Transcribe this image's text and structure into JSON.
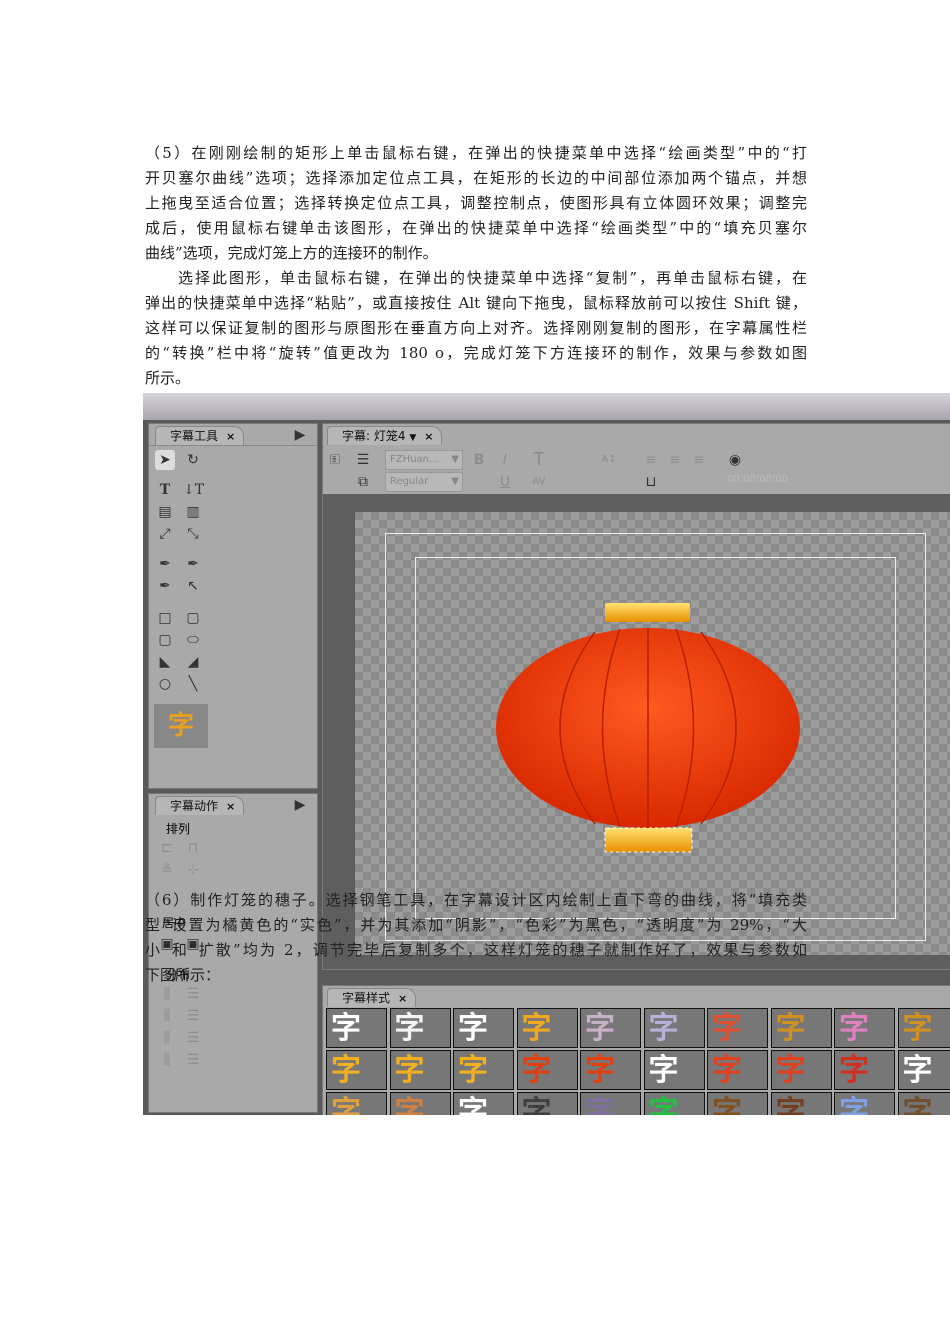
{
  "paragraph1": [
    "（5）在刚刚绘制的矩形上单击鼠标右键，在弹出的快捷菜单中选择“绘画类型”中的“打",
    "开贝塞尔曲线”选项；选择添加定位点工具，在矩形的长边的中间部位添加两个锚点，并想",
    "上拖曳至适合位置；选择转换定位点工具，调整控制点，使图形具有立体圆环效果；调整完",
    "成后，使用鼠标右键单击该图形，在弹出的快捷菜单中选择“绘画类型”中的“填充贝塞尔",
    "曲线”选项，完成灯笼上方的连接环的制作。"
  ],
  "paragraph2": [
    "选择此图形，单击鼠标右键，在弹出的快捷菜单中选择“复制”，再单击鼠标右键，在",
    "弹出的快捷菜单中选择“粘贴”，或直接按住 Alt 键向下拖曳，鼠标释放前可以按住 Shift 键，",
    "这样可以保证复制的图形与原图形在垂直方向上对齐。选择刚刚复制的图形，在字幕属性栏",
    "的“转换”栏中将“旋转”值更改为 180 o，完成灯笼下方连接环的制作，效果与参数如图",
    "所示。"
  ],
  "paragraph3": [
    "（6）制作灯笼的穗子。选择钢笔工具，在字幕设计区内绘制上直下弯的曲线，将“填充类",
    "型”设置为橘黄色的“实色”，并为其添加“阴影”，“色彩”为黑色，“透明度”为 29%，“大",
    "小”和“扩散”均为 2，调节完毕后复制多个，这样灯笼的穗子就制作好了，效果与参数如",
    "下图所示："
  ],
  "screenshot": {
    "tools_panel": {
      "title": "字幕工具",
      "close": "×"
    },
    "actions_panel": {
      "title": "字幕动作",
      "close": "×",
      "arrange": "排列",
      "center": "居中",
      "distribute": "分布"
    },
    "title_tab": {
      "label": "字幕: 灯笼4",
      "close": "×"
    },
    "toolbar": {
      "font": "FZHuan...",
      "style": "Regular",
      "bold": "B",
      "italic": "I",
      "underline": "U",
      "timecode": "00;00;00;00"
    },
    "styles_panel": {
      "title": "字幕样式",
      "close": "×",
      "sample_char": "字",
      "cell_colors": [
        "#ffffff",
        "#f4f4f4",
        "#ffffff",
        "#f0a820",
        "#c8b0c8",
        "#b8b0d8",
        "#e05030",
        "#d09020",
        "#e080c0",
        "#d09020",
        "#f0b020",
        "#f0b020",
        "#f0b020",
        "#e04010",
        "#e04010",
        "#ffffff",
        "#e04020",
        "#e04020",
        "#d03020",
        "#ffffff",
        "#e0a040",
        "#d08040",
        "#ffffff",
        "#404040",
        "#8070a0",
        "#20c040",
        "#805020",
        "#704020",
        "#80a0e0",
        "#705030"
      ]
    }
  }
}
